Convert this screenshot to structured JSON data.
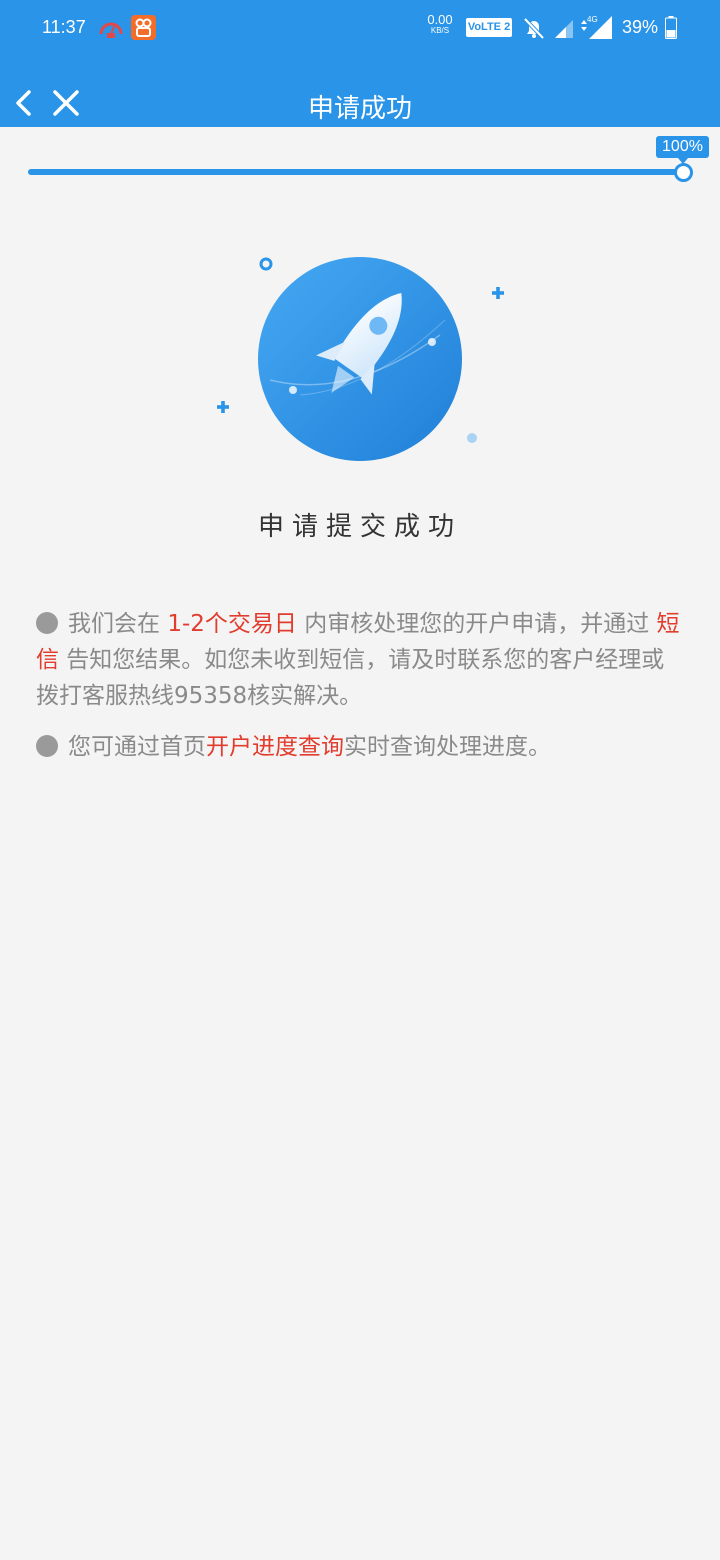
{
  "status_bar": {
    "time": "11:37",
    "net_speed_value": "0.00",
    "net_speed_unit": "KB/S",
    "volte": "VoLTE 2",
    "signal_label": "4G",
    "battery": "39%"
  },
  "nav": {
    "title": "申请成功",
    "back_icon": "chevron-left-icon",
    "close_icon": "close-icon"
  },
  "progress": {
    "label": "100%",
    "value": 1.0
  },
  "hero": {
    "icon": "rocket-icon"
  },
  "success_title": "申请提交成功",
  "notes": [
    {
      "before": "我们会在 ",
      "highlight1": "1-2个交易日",
      "middle": " 内审核处理您的开户申请，并通过 ",
      "highlight2": "短信",
      "after": " 告知您结果。如您未收到短信，请及时联系您的客户经理或拨打客服热线95358核实解决。"
    },
    {
      "before": "您可通过首页",
      "highlight": "开户进度查询",
      "after": "实时查询处理进度。"
    }
  ],
  "colors": {
    "brand": "#2a94e8",
    "highlight": "#e23c2e",
    "background": "#f4f4f4"
  }
}
